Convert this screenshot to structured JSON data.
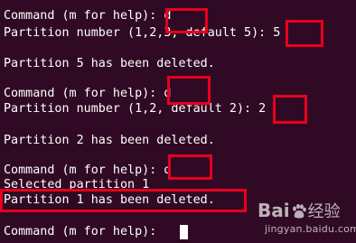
{
  "terminal": {
    "lines": [
      "Command (m for help): d",
      "Partition number (1,2,3, default 5): 5",
      "",
      "Partition 5 has been deleted.",
      "",
      "Command (m for help): d",
      "Partition number (1,2, default 2): 2",
      "",
      "Partition 2 has been deleted.",
      "",
      "Command (m for help): d",
      "Selected partition 1",
      "Partition 1 has been deleted.",
      "",
      "Command (m for help): "
    ]
  },
  "watermark": {
    "brand_left": "Bai",
    "brand_right": "经验",
    "domain": "jingyan.baidu.com"
  },
  "colors": {
    "background": "#300a24",
    "text": "#ffffff",
    "highlight_box": "#e8001c"
  }
}
